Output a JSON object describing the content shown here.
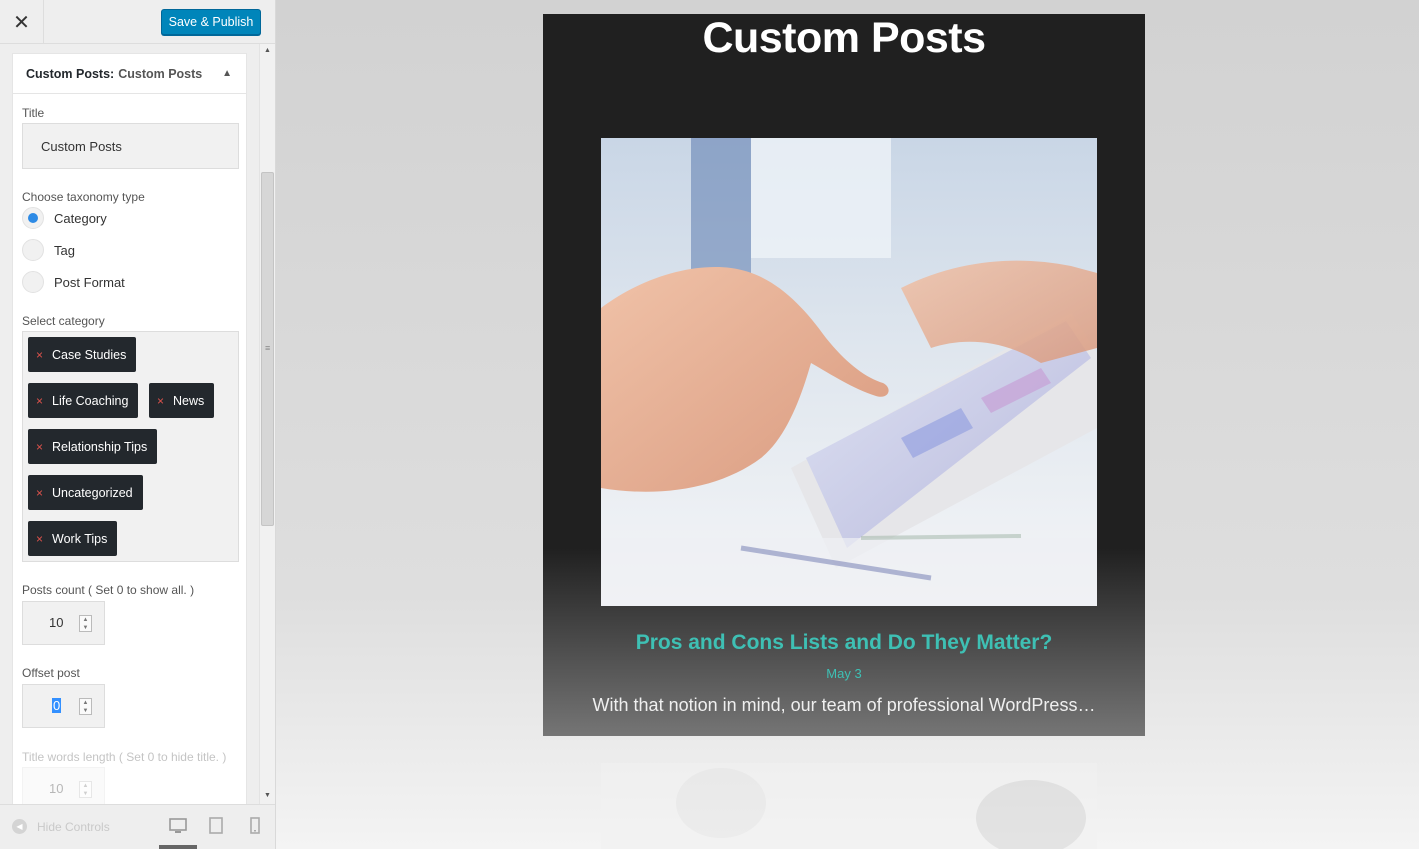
{
  "topbar": {
    "close_glyph": "✕",
    "publish_label": "Save & Publish"
  },
  "widget": {
    "title_bold": "Custom Posts:",
    "title_sub": "Custom Posts",
    "collapse_glyph": "▲",
    "title_label": "Title",
    "title_value": "Custom Posts",
    "taxonomy_label": "Choose taxonomy type",
    "taxonomy_options": [
      {
        "label": "Category",
        "checked": true
      },
      {
        "label": "Tag",
        "checked": false
      },
      {
        "label": "Post Format",
        "checked": false
      }
    ],
    "category_label": "Select category",
    "remove_glyph": "×",
    "categories": [
      "Case Studies",
      "Life Coaching",
      "News",
      "Relationship Tips",
      "Uncategorized",
      "Work Tips"
    ],
    "posts_count_label": "Posts count ( Set 0 to show all. )",
    "posts_count_value": "10",
    "offset_label": "Offset post",
    "offset_value": "0",
    "title_words_label": "Title words length ( Set 0 to hide title. )",
    "title_words_value": "10"
  },
  "footer": {
    "hide_label": "Hide Controls",
    "devices": [
      "desktop-icon",
      "tablet-icon",
      "mobile-icon"
    ]
  },
  "preview": {
    "section_title": "Custom Posts",
    "post_title": "Pros and Cons Lists and Do They Matter?",
    "post_date": "May 3",
    "post_excerpt": "With that notion in mind, our team of professional WordPress…"
  },
  "colors": {
    "publish": "#0085ba",
    "accent": "#3ec0b4",
    "tag_bg": "#23282d",
    "remove_x": "#e0534c",
    "radio_on": "#2d8ae5"
  }
}
